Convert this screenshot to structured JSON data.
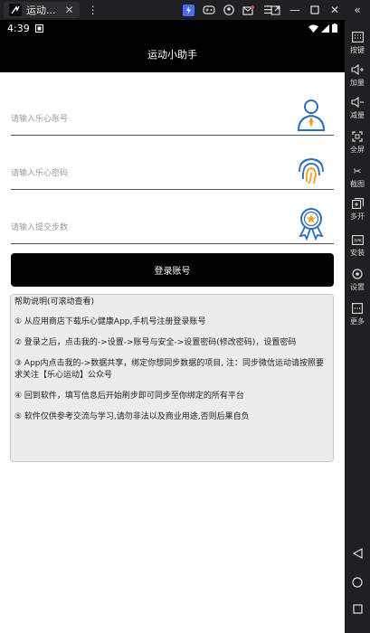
{
  "emulator": {
    "tab_title": "运动...",
    "collapse_glyph": "«",
    "sidebar": [
      {
        "key": "keys",
        "label": "按键",
        "icon": "keyboard-icon"
      },
      {
        "key": "volup",
        "label": "加量",
        "icon": "volume-up-icon"
      },
      {
        "key": "voldown",
        "label": "减量",
        "icon": "volume-down-icon"
      },
      {
        "key": "fullscreen",
        "label": "全屏",
        "icon": "fullscreen-icon"
      },
      {
        "key": "screenshot",
        "label": "截图",
        "icon": "scissors-icon"
      },
      {
        "key": "multi",
        "label": "多开",
        "icon": "multi-instance-icon"
      },
      {
        "key": "install",
        "label": "安装",
        "icon": "apk-install-icon"
      },
      {
        "key": "settings",
        "label": "设置",
        "icon": "gear-icon"
      },
      {
        "key": "more",
        "label": "更多",
        "icon": "more-icon"
      }
    ]
  },
  "status": {
    "time": "4:39"
  },
  "app": {
    "title": "运动小助手",
    "account_placeholder": "请输入乐心账号",
    "password_placeholder": "请输入乐心密码",
    "steps_placeholder": "请输入提交步数",
    "login_label": "登录账号",
    "help": {
      "title": "帮助说明(可滚动查看)",
      "items": [
        "① 从应用商店下载乐心健康App,手机号注册登录账号",
        "② 登录之后，点击我的->设置->账号与安全->设置密码(修改密码)，设置密码",
        "③ App内点击我的->数据共享，绑定你想同步数据的项目, 注：同步微信运动请按照要求关注【乐心运动】公众号",
        "④ 回到软件，填写信息后开始刷步即可同步至你绑定的所有平台",
        "⑤ 软件仅供参考交流与学习,请勿非法以及商业用途,否则后果自负"
      ]
    }
  }
}
